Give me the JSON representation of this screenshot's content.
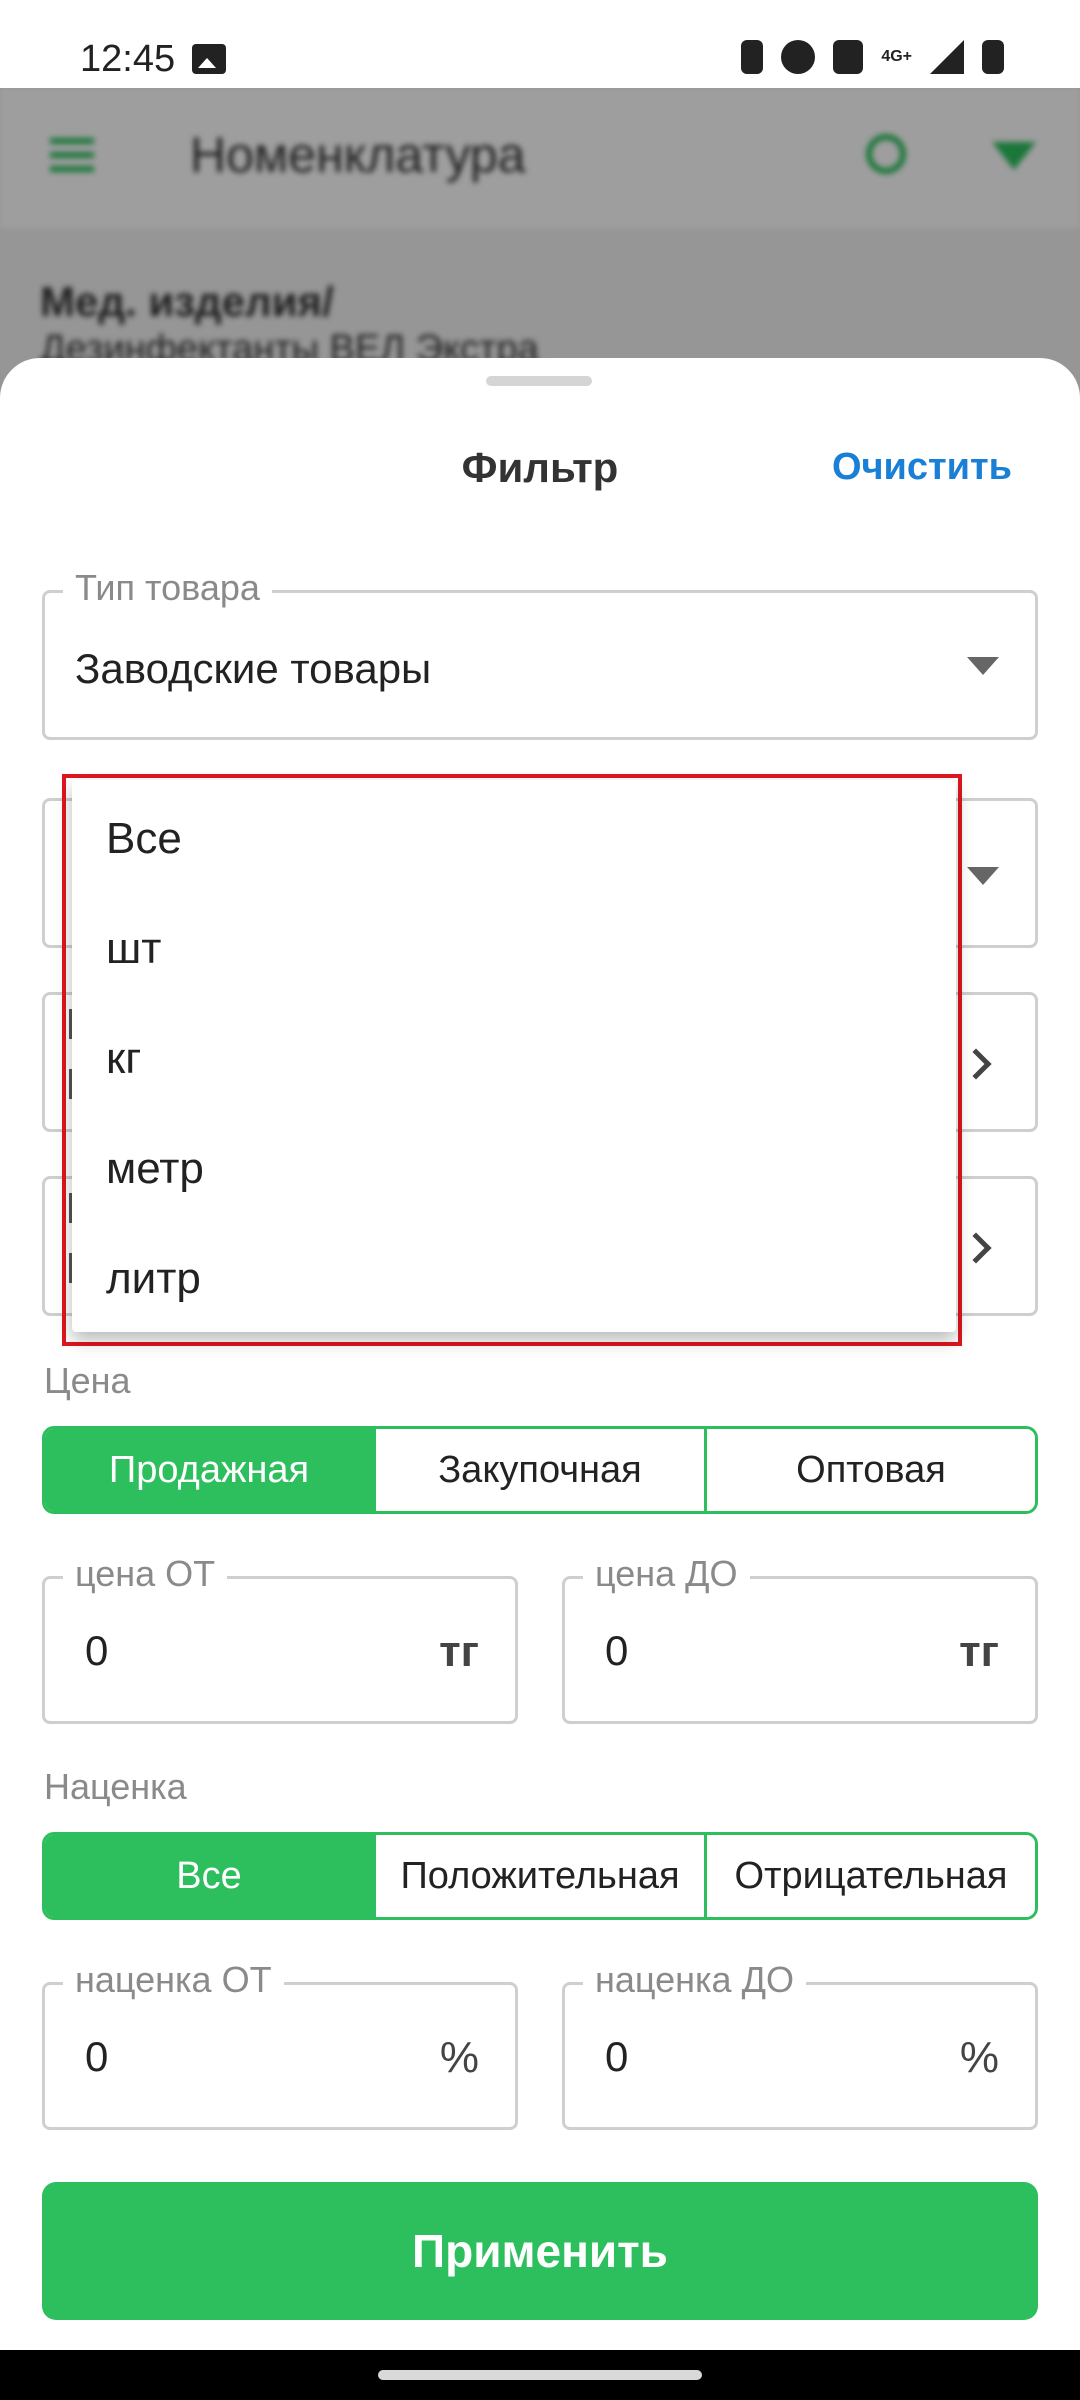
{
  "status_bar": {
    "time": "12:45",
    "network": "4G+",
    "icons": [
      "image-icon",
      "battery-saver-icon",
      "alarm-icon",
      "mute-icon",
      "signal-icon",
      "battery-icon"
    ]
  },
  "background": {
    "title": "Номенклатура",
    "line1": "Мед. изделия/",
    "line2": "Дезинфектанты ВЕЛ Экстра"
  },
  "sheet": {
    "title": "Фильтр",
    "clear_label": "Очистить",
    "product_type": {
      "label": "Тип товара",
      "value": "Заводские товары"
    },
    "price": {
      "label": "Цена",
      "tabs": [
        "Продажная",
        "Закупочная",
        "Оптовая"
      ],
      "active_index": 0,
      "from_label": "цена ОТ",
      "from_value": "0",
      "to_label": "цена ДО",
      "to_value": "0",
      "unit": "тг"
    },
    "markup": {
      "label": "Наценка",
      "tabs": [
        "Все",
        "Положительная",
        "Отрицательная"
      ],
      "active_index": 0,
      "from_label": "наценка ОТ",
      "from_value": "0",
      "to_label": "наценка ДО",
      "to_value": "0",
      "unit": "%"
    },
    "apply_label": "Применить"
  },
  "dropdown": {
    "options": [
      "Все",
      "шт",
      "кг",
      "метр",
      "литр"
    ]
  },
  "colors": {
    "accent": "#2dbf5e",
    "link": "#1a7fd6",
    "highlight": "#e0161f"
  }
}
